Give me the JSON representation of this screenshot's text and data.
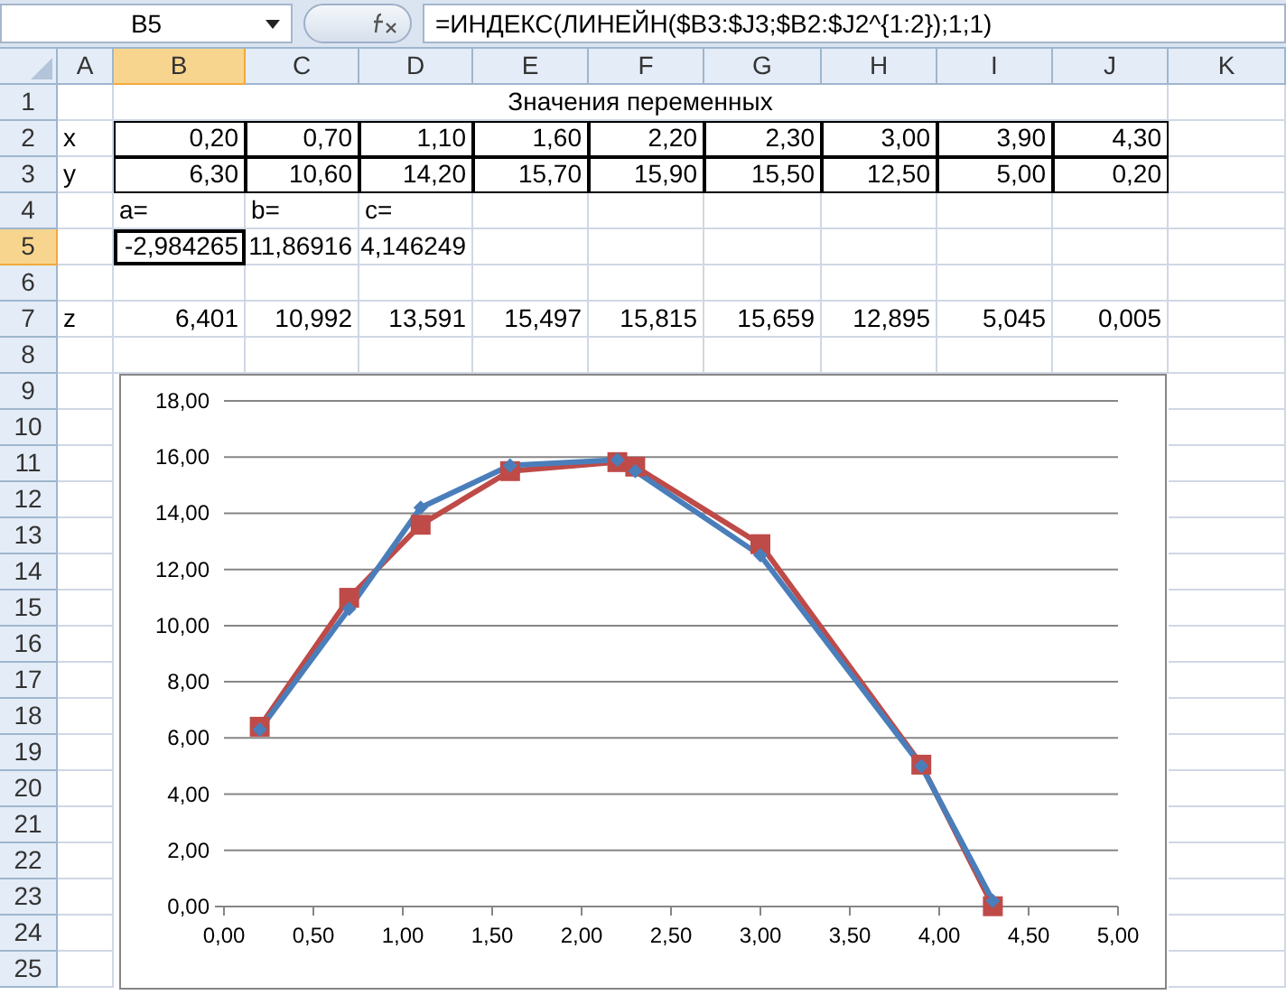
{
  "formula_bar": {
    "name_box": "B5",
    "formula": "=ИНДЕКС(ЛИНЕЙН($B3:$J3;$B2:$J2^{1:2});1;1)"
  },
  "columns": [
    {
      "label": "A",
      "selected": false
    },
    {
      "label": "B",
      "selected": true
    },
    {
      "label": "C",
      "selected": false
    },
    {
      "label": "D",
      "selected": false
    },
    {
      "label": "E",
      "selected": false
    },
    {
      "label": "F",
      "selected": false
    },
    {
      "label": "G",
      "selected": false
    },
    {
      "label": "H",
      "selected": false
    },
    {
      "label": "I",
      "selected": false
    },
    {
      "label": "J",
      "selected": false
    },
    {
      "label": "K",
      "selected": false
    }
  ],
  "rows": [
    {
      "number": "1",
      "selected": false,
      "cells": {
        "B": {
          "kind": "title",
          "text": "Значения переменных",
          "boxed": false,
          "selected": false
        }
      }
    },
    {
      "number": "2",
      "selected": false,
      "cells": {
        "A": {
          "kind": "text",
          "text": "x",
          "boxed": false,
          "selected": false
        },
        "B": {
          "kind": "number",
          "text": "0,20",
          "boxed": true,
          "selected": false
        },
        "C": {
          "kind": "number",
          "text": "0,70",
          "boxed": true,
          "selected": false
        },
        "D": {
          "kind": "number",
          "text": "1,10",
          "boxed": true,
          "selected": false
        },
        "E": {
          "kind": "number",
          "text": "1,60",
          "boxed": true,
          "selected": false
        },
        "F": {
          "kind": "number",
          "text": "2,20",
          "boxed": true,
          "selected": false
        },
        "G": {
          "kind": "number",
          "text": "2,30",
          "boxed": true,
          "selected": false
        },
        "H": {
          "kind": "number",
          "text": "3,00",
          "boxed": true,
          "selected": false
        },
        "I": {
          "kind": "number",
          "text": "3,90",
          "boxed": true,
          "selected": false
        },
        "J": {
          "kind": "number",
          "text": "4,30",
          "boxed": true,
          "selected": false
        }
      }
    },
    {
      "number": "3",
      "selected": false,
      "cells": {
        "A": {
          "kind": "text",
          "text": "y",
          "boxed": false,
          "selected": false
        },
        "B": {
          "kind": "number",
          "text": "6,30",
          "boxed": true,
          "selected": false
        },
        "C": {
          "kind": "number",
          "text": "10,60",
          "boxed": true,
          "selected": false
        },
        "D": {
          "kind": "number",
          "text": "14,20",
          "boxed": true,
          "selected": false
        },
        "E": {
          "kind": "number",
          "text": "15,70",
          "boxed": true,
          "selected": false
        },
        "F": {
          "kind": "number",
          "text": "15,90",
          "boxed": true,
          "selected": false
        },
        "G": {
          "kind": "number",
          "text": "15,50",
          "boxed": true,
          "selected": false
        },
        "H": {
          "kind": "number",
          "text": "12,50",
          "boxed": true,
          "selected": false
        },
        "I": {
          "kind": "number",
          "text": "5,00",
          "boxed": true,
          "selected": false
        },
        "J": {
          "kind": "number",
          "text": "0,20",
          "boxed": true,
          "selected": false
        }
      }
    },
    {
      "number": "4",
      "selected": false,
      "cells": {
        "B": {
          "kind": "text",
          "text": "a=",
          "boxed": false,
          "selected": false
        },
        "C": {
          "kind": "text",
          "text": "b=",
          "boxed": false,
          "selected": false
        },
        "D": {
          "kind": "text",
          "text": "c=",
          "boxed": false,
          "selected": false
        }
      }
    },
    {
      "number": "5",
      "selected": true,
      "cells": {
        "B": {
          "kind": "number",
          "text": "-2,984265",
          "boxed": false,
          "selected": true
        },
        "C": {
          "kind": "number",
          "text": "11,86916",
          "boxed": false,
          "selected": false
        },
        "D": {
          "kind": "number",
          "text": "4,146249",
          "boxed": false,
          "selected": false
        }
      }
    },
    {
      "number": "6",
      "selected": false
    },
    {
      "number": "7",
      "selected": false,
      "cells": {
        "A": {
          "kind": "text",
          "text": "z",
          "boxed": false,
          "selected": false
        },
        "B": {
          "kind": "number",
          "text": "6,401",
          "boxed": false,
          "selected": false
        },
        "C": {
          "kind": "number",
          "text": "10,992",
          "boxed": false,
          "selected": false
        },
        "D": {
          "kind": "number",
          "text": "13,591",
          "boxed": false,
          "selected": false
        },
        "E": {
          "kind": "number",
          "text": "15,497",
          "boxed": false,
          "selected": false
        },
        "F": {
          "kind": "number",
          "text": "15,815",
          "boxed": false,
          "selected": false
        },
        "G": {
          "kind": "number",
          "text": "15,659",
          "boxed": false,
          "selected": false
        },
        "H": {
          "kind": "number",
          "text": "12,895",
          "boxed": false,
          "selected": false
        },
        "I": {
          "kind": "number",
          "text": "5,045",
          "boxed": false,
          "selected": false
        },
        "J": {
          "kind": "number",
          "text": "0,005",
          "boxed": false,
          "selected": false
        }
      }
    },
    {
      "number": "8",
      "selected": false
    },
    {
      "number": "9",
      "selected": false
    },
    {
      "number": "10",
      "selected": false
    },
    {
      "number": "11",
      "selected": false
    },
    {
      "number": "12",
      "selected": false
    },
    {
      "number": "13",
      "selected": false
    },
    {
      "number": "14",
      "selected": false
    },
    {
      "number": "15",
      "selected": false
    },
    {
      "number": "16",
      "selected": false
    },
    {
      "number": "17",
      "selected": false
    },
    {
      "number": "18",
      "selected": false
    },
    {
      "number": "19",
      "selected": false
    },
    {
      "number": "20",
      "selected": false
    },
    {
      "number": "21",
      "selected": false
    },
    {
      "number": "22",
      "selected": false
    },
    {
      "number": "23",
      "selected": false
    },
    {
      "number": "24",
      "selected": false
    },
    {
      "number": "25",
      "selected": false
    }
  ],
  "chart": {
    "chart_data": {
      "type": "line",
      "grid": true,
      "x": [
        0.2,
        0.7,
        1.1,
        1.6,
        2.2,
        2.3,
        3.0,
        3.9,
        4.3
      ],
      "series": [
        {
          "color": "#be4b48",
          "marker": "square",
          "values": [
            6.4,
            10.99,
            13.59,
            15.5,
            15.82,
            15.66,
            12.9,
            5.05,
            0.01
          ]
        },
        {
          "color": "#4a7ebb",
          "marker": "diamond",
          "values": [
            6.3,
            10.6,
            14.2,
            15.7,
            15.9,
            15.5,
            12.5,
            5.0,
            0.2
          ]
        }
      ],
      "xlim": [
        0,
        5
      ],
      "ylim": [
        0,
        18
      ],
      "xticks": [
        {
          "value": 0,
          "label": "0,00"
        },
        {
          "value": 0.5,
          "label": "0,50"
        },
        {
          "value": 1,
          "label": "1,00"
        },
        {
          "value": 1.5,
          "label": "1,50"
        },
        {
          "value": 2,
          "label": "2,00"
        },
        {
          "value": 2.5,
          "label": "2,50"
        },
        {
          "value": 3,
          "label": "3,00"
        },
        {
          "value": 3.5,
          "label": "3,50"
        },
        {
          "value": 4,
          "label": "4,00"
        },
        {
          "value": 4.5,
          "label": "4,50"
        },
        {
          "value": 5,
          "label": "5,00"
        }
      ],
      "yticks": [
        {
          "value": 0,
          "label": "0,00"
        },
        {
          "value": 2,
          "label": "2,00"
        },
        {
          "value": 4,
          "label": "4,00"
        },
        {
          "value": 6,
          "label": "6,00"
        },
        {
          "value": 8,
          "label": "8,00"
        },
        {
          "value": 10,
          "label": "10,00"
        },
        {
          "value": 12,
          "label": "12,00"
        },
        {
          "value": 14,
          "label": "14,00"
        },
        {
          "value": 16,
          "label": "16,00"
        },
        {
          "value": 18,
          "label": "18,00"
        }
      ]
    }
  }
}
